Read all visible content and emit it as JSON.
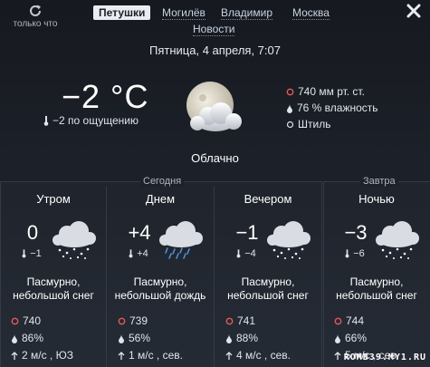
{
  "colors": {
    "pressure": "#e5595a",
    "accent_tab_bg": "#e9edf2",
    "background": "#1b1f26"
  },
  "toolbar": {
    "refresh_label": "только что",
    "refresh_icon": "refresh-icon",
    "close_icon": "close-icon"
  },
  "tabs": [
    {
      "label": "Петушки",
      "active": true
    },
    {
      "label": "Могилёв"
    },
    {
      "label": "Владимир"
    },
    {
      "label": "Москва"
    },
    {
      "label": "Новости"
    }
  ],
  "current": {
    "date": "Пятница, 4 апреля, 7:07",
    "temperature": "−2 °C",
    "feels_like": "−2 по ощущению",
    "condition": "Облачно",
    "pressure": "740 мм рт. ст.",
    "humidity": "76 % влажность",
    "wind": "Штиль"
  },
  "sections": {
    "today": "Сегодня",
    "tomorrow": "Завтра"
  },
  "periods": [
    {
      "title": "Утром",
      "temp": "0",
      "feels": "−1",
      "desc_line1": "Пасмурно,",
      "desc_line2": "небольшой снег",
      "pressure": "740",
      "humidity": "86%",
      "wind": "2 м/с , ЮЗ",
      "precip": "snow"
    },
    {
      "title": "Днем",
      "temp": "+4",
      "feels": "+4",
      "desc_line1": "Пасмурно,",
      "desc_line2": "небольшой дождь",
      "pressure": "739",
      "humidity": "56%",
      "wind": "1 м/с , сев.",
      "precip": "rain"
    },
    {
      "title": "Вечером",
      "temp": "−1",
      "feels": "−4",
      "desc_line1": "Пасмурно,",
      "desc_line2": "небольшой снег",
      "pressure": "741",
      "humidity": "88%",
      "wind": "4 м/с , сев.",
      "precip": "snow"
    },
    {
      "title": "Ночью",
      "temp": "−3",
      "feels": "−6",
      "desc_line1": "Пасмурно,",
      "desc_line2": "небольшой снег",
      "pressure": "744",
      "humidity": "66%",
      "wind": "5 м/с , сев.",
      "precip": "snow"
    }
  ],
  "watermark": "ROMB39.MY1.RU"
}
